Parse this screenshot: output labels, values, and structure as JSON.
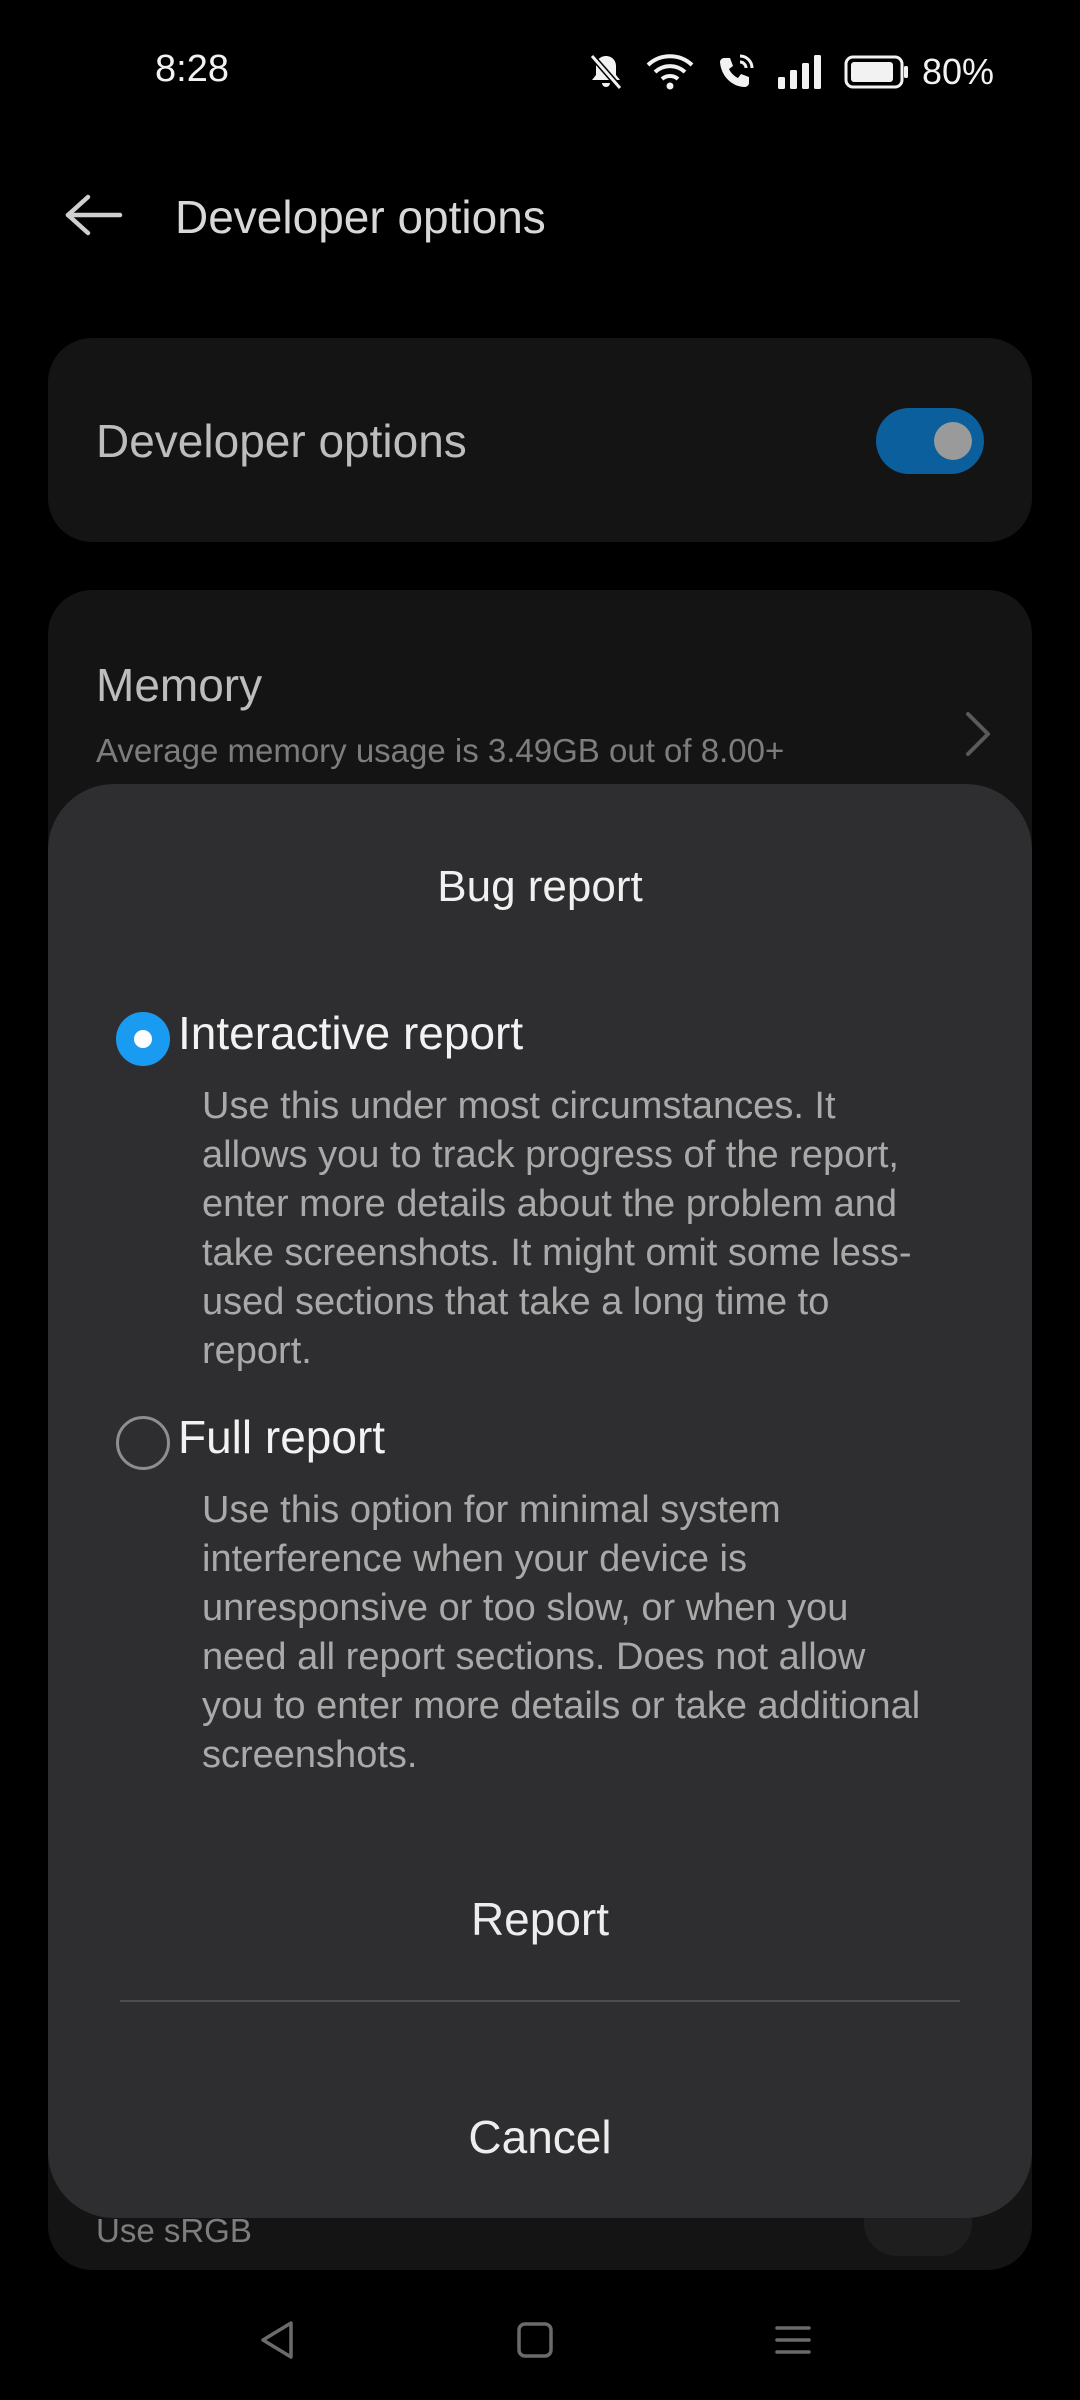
{
  "status_bar": {
    "time": "8:28",
    "battery": "80%",
    "icons": [
      "notifications-off-icon",
      "wifi-icon",
      "wifi-calling-icon",
      "signal-icon",
      "battery-icon"
    ]
  },
  "app_bar": {
    "title": "Developer options",
    "back_icon": "arrow-left-icon"
  },
  "settings": {
    "developer_options_label": "Developer options",
    "developer_options_enabled": true,
    "memory_title": "Memory",
    "memory_subtitle": "Average memory usage is 3.49GB out of 8.00+",
    "srgb_label": "Use sRGB"
  },
  "dialog": {
    "title": "Bug report",
    "options": [
      {
        "label": "Interactive report",
        "selected": true,
        "description": "Use this under most circumstances. It allows you to track progress of the report, enter more details about the problem and take screenshots. It might omit some less-used sections that take a long time to report."
      },
      {
        "label": "Full report",
        "selected": false,
        "description": "Use this option for minimal system interference when your device is unresponsive or too slow, or when you need all report sections. Does not allow you to enter more details or take additional screenshots."
      }
    ],
    "report_label": "Report",
    "cancel_label": "Cancel"
  },
  "nav_bar": {
    "icons": [
      "back-triangle-icon",
      "home-square-icon",
      "recents-menu-icon"
    ]
  },
  "colors": {
    "accent": "#1a9bf2",
    "toggle_on": "#0a5f9c",
    "dialog_bg": "#2e2e30",
    "background": "#000000"
  }
}
